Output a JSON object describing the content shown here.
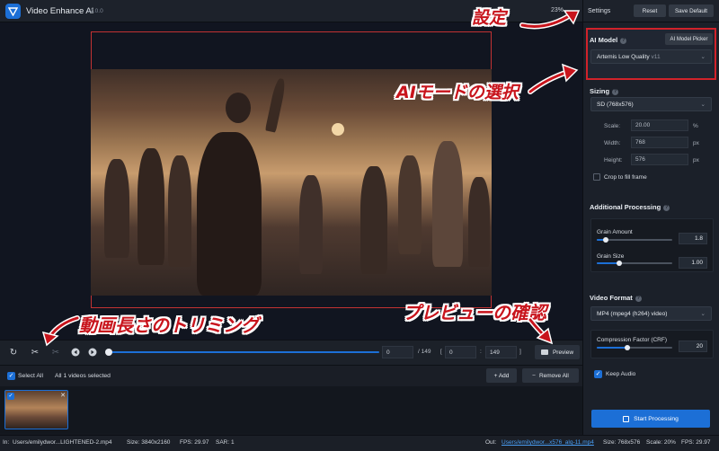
{
  "app": {
    "title": "Video Enhance AI",
    "version": "v2.0.0",
    "zoom": "23%"
  },
  "settings": {
    "label": "Settings",
    "reset": "Reset",
    "save_default": "Save Default"
  },
  "ai_model": {
    "title": "AI Model",
    "picker": "AI Model Picker",
    "selected": "Artemis Low Quality",
    "selected_version": "v11"
  },
  "sizing": {
    "title": "Sizing",
    "preset": "SD (768x576)",
    "scale_label": "Scale:",
    "scale_value": "20.00",
    "scale_unit": "%",
    "width_label": "Width:",
    "width_value": "768",
    "width_unit": "px",
    "height_label": "Height:",
    "height_value": "576",
    "height_unit": "px",
    "crop_label": "Crop to fill frame"
  },
  "processing": {
    "title": "Additional Processing",
    "grain_amount_label": "Grain Amount",
    "grain_amount_value": "1.8",
    "grain_amount_level": 0.12,
    "grain_size_label": "Grain Size",
    "grain_size_value": "1.00",
    "grain_size_level": 0.3
  },
  "video_format": {
    "title": "Video Format",
    "format": "MP4 (mpeg4 (h264) video)",
    "compression_label": "Compression Factor (CRF)",
    "compression_value": "20",
    "compression_level": 0.4,
    "keep_audio_label": "Keep Audio"
  },
  "start_processing": "Start Processing",
  "timeline": {
    "current_frame": "0",
    "total": "/ 149",
    "bracket_open": "[",
    "range_start": "0",
    "range_sep": ":",
    "range_end": "149",
    "bracket_close": "]",
    "preview": "Preview"
  },
  "list": {
    "select_all": "Select All",
    "selected_count": "All 1 videos selected",
    "add": "+ Add",
    "remove_all": "Remove All"
  },
  "status": {
    "in_label": "In:",
    "in_path": "Users/emilydwor...LIGHTENED-2.mp4",
    "in_size": "Size: 3840x2160",
    "in_fps": "FPS: 29.97",
    "in_sar": "SAR: 1",
    "out_label": "Out:",
    "out_path": "Users/emilydwor...x576_alq-11.mp4",
    "out_size": "Size: 768x576",
    "out_scale": "Scale: 20%",
    "out_fps": "FPS: 29.97"
  },
  "annotations": {
    "settings": "設定",
    "ai_model": "AIモードの選択",
    "trimming": "動画長さのトリミング",
    "preview": "プレビューの確認"
  },
  "colors": {
    "accent": "#1c6fd6",
    "annotation": "#c8141c"
  }
}
